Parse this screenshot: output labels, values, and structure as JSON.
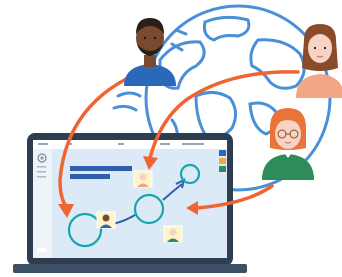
{
  "illustration": {
    "subject": "remote-collaboration",
    "colors": {
      "globe_line": "#4a90d9",
      "globe_fill": "#ffffff",
      "arrow": "#f06432",
      "laptop_frame": "#2e3e50",
      "laptop_base": "#3d4f64",
      "screen_bg": "#dbeaf6",
      "sidebar": "#eef3f8",
      "header_bar": "#2f5fa8",
      "node_stroke": "#15a6b0",
      "thumb_bg": "#fff4c8",
      "skin_dark": "#7a4a2e",
      "skin_light": "#f6d3c4",
      "hair_brown": "#8a4b2a",
      "hair_red": "#e8743a",
      "shirt_blue": "#2a69b8",
      "shirt_salmon": "#f3a685",
      "shirt_green": "#2d8c5a"
    },
    "icons": [
      "person-dark-hair-icon",
      "person-brown-hair-icon",
      "person-red-hair-icon",
      "globe-icon",
      "laptop-icon"
    ]
  }
}
